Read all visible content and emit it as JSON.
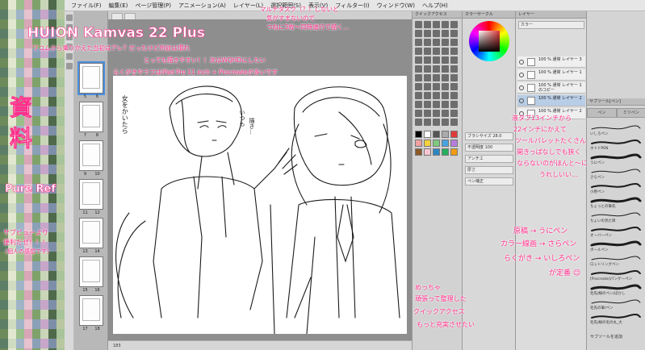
{
  "colors": {
    "accent_pink": "#ff2d8a",
    "selection_blue": "#b8cde6"
  },
  "menu": {
    "items": [
      "ファイル(F)",
      "編集(E)",
      "ページ管理(P)",
      "アニメーション(A)",
      "レイヤー(L)",
      "選択範囲(S)",
      "表示(V)",
      "フィルター(I)",
      "ウィンドウ(W)",
      "ヘルプ(H)"
    ]
  },
  "canvas": {
    "tabs": [
      "",
      ""
    ],
    "page_numbers": [
      "5",
      "6",
      "7",
      "8",
      "9",
      "10",
      "11",
      "12",
      "13",
      "14",
      "15",
      "16",
      "17",
      "18"
    ],
    "status_zoom": "183"
  },
  "annotations": {
    "title": "HUION Kamvas 22 Plus",
    "intro_1": "ワコムから乗りかえた当初はアレ？だったけど所詮は慣れ",
    "intro_2": "とっても描きやすい！！次はWQHDにしたい",
    "intro_3": "らくがきやラフはiPad Pro 11 inch + Procreateが多いです",
    "multitask_1": "マルチタスク（？）しないと",
    "multitask_2": "気がすまないので",
    "multitask_3": "つねに3枚～同時進行で描く…",
    "shiryou_1": "資",
    "shiryou_2": "料",
    "pureref": "Pure Ref",
    "pureref_note_1": "サブビューより",
    "pureref_note_2": "便利だぜ！！！",
    "pureref_note_3": "（個人の感想です）",
    "liquid_1": "液タブ13インチから",
    "liquid_2": "22インチにかえて",
    "liquid_3": "ツールパレットたくさん",
    "liquid_4": "開きっぱなしでも狭く",
    "liquid_5": "ならないのがほんと～に",
    "liquid_6": "うれしいい…",
    "pens_1": "原稿 → うにペン",
    "pens_2": "カラー線画 → さらペン",
    "pens_3": "らくがき → いしろペン",
    "pens_4": "が定番 😉",
    "quick_1": "めっちゃ",
    "quick_2": "頑張って整理した",
    "quick_3": "クイックアクセス",
    "quick_4": "もっと充実させたい",
    "sketch_1": "女をかいたら",
    "sketch_2": "いつも",
    "sketch_3": "描き…"
  },
  "panels": {
    "quick_access_head": "クイックアクセス",
    "color_head": "カラーサークル",
    "layer_head": "レイヤー",
    "layers": [
      "100 % 通常 レイヤー 3",
      "100 % 通常 レイヤー 1",
      "100 % 通常 レイヤー 1のコピー",
      "100 % 通常 レイヤー 2",
      "100 % 通常 レイヤー 2"
    ],
    "layer_mode": "カラー",
    "brush_head": "サブツール[ペン]",
    "brush_tabs": [
      "ペン",
      "ミリペン"
    ],
    "brush_size_label": "ブラシサイズ",
    "brush_size_value": "28.0",
    "opacity_label": "不透明度",
    "opacity_value": "100",
    "anti_alias_label": "アンチエ",
    "thickness_label": "厚さ",
    "stabilizer_label": "ペン補正",
    "brush_list": [
      "いしろペン",
      "ホトドPEN",
      "うにペン",
      "さらペン",
      "小原ペン",
      "ちょっとの筆先",
      "ちょいの見た目",
      "オーバーペン",
      "ボールペン",
      "ロットリングペン",
      "[Procreate]パンゲーペン",
      "毛先/線のペン/ぼかし",
      "毛先の筆/ペン",
      "毛先/線の毛の丸_大"
    ],
    "add_subtool": "サブツールを追加"
  }
}
